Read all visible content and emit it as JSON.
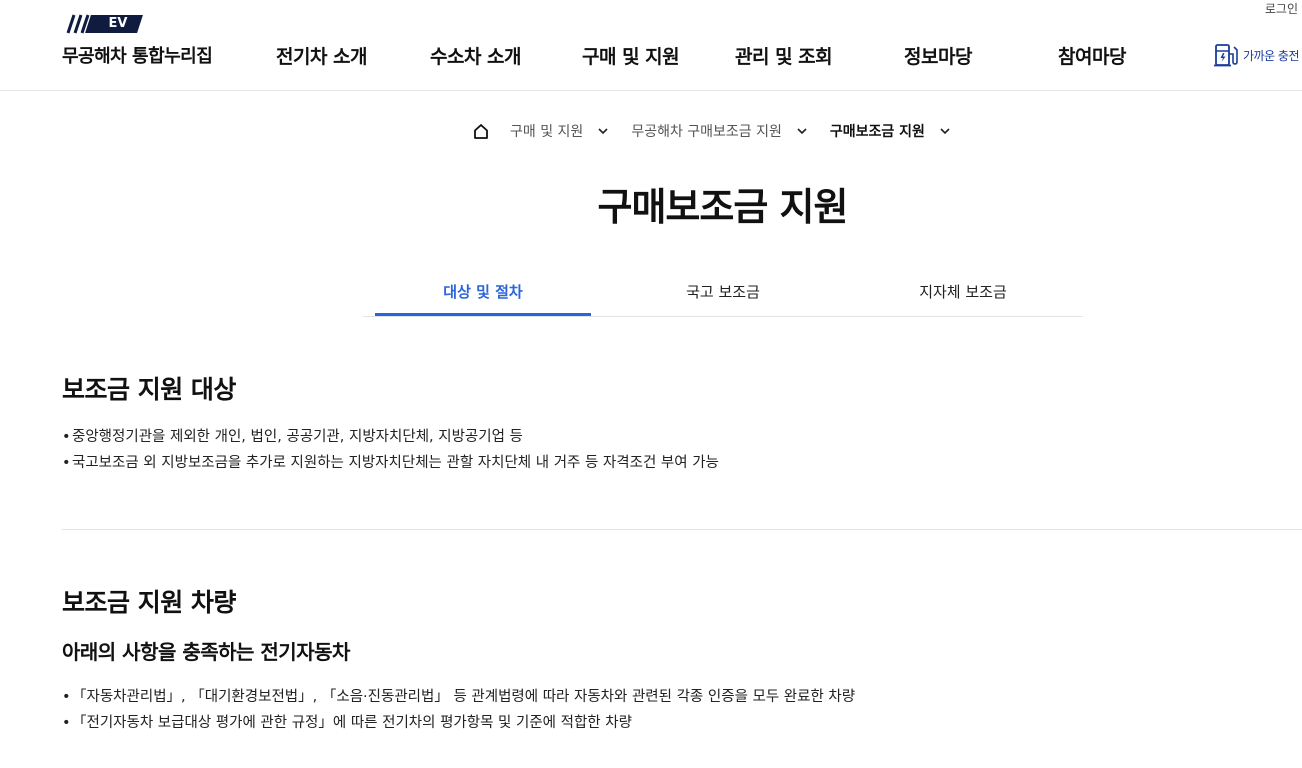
{
  "header": {
    "logo_badge": "EV",
    "logo_title": "무공해차 통합누리집",
    "login": "로그인",
    "nav": [
      "전기차 소개",
      "수소차 소개",
      "구매 및 지원",
      "관리 및 조회",
      "정보마당",
      "참여마당"
    ],
    "charge_label": "가까운 충전"
  },
  "breadcrumb": {
    "home_icon": "home-icon",
    "items": [
      "구매 및 지원",
      "무공해차 구매보조금 지원",
      "구매보조금 지원"
    ]
  },
  "page_title": "구매보조금 지원",
  "tabs": [
    {
      "label": "대상 및 절차",
      "active": true
    },
    {
      "label": "국고 보조금",
      "active": false
    },
    {
      "label": "지자체 보조금",
      "active": false
    }
  ],
  "sections": [
    {
      "title": "보조금 지원 대상",
      "bullets": [
        "중앙행정기관을 제외한 개인, 법인, 공공기관, 지방자치단체, 지방공기업 등",
        "국고보조금 외 지방보조금을 추가로 지원하는 지방자치단체는 관할 자치단체 내 거주 등 자격조건 부여 가능"
      ]
    },
    {
      "title": "보조금 지원 차량",
      "subtitle": "아래의 사항을 충족하는 전기자동차",
      "bullets": [
        "「자동차관리법」, 「대기환경보전법」, 「소음·진동관리법」 등 관계법령에 따라 자동차와 관련된 각종 인증을 모두 완료한 차량",
        "「전기자동차 보급대상 평가에 관한 규정」에 따른 전기차의 평가항목 및 기준에 적합한 차량"
      ]
    }
  ],
  "colors": {
    "accent": "#2a66d9",
    "logo_navy": "#0f1c3f"
  }
}
